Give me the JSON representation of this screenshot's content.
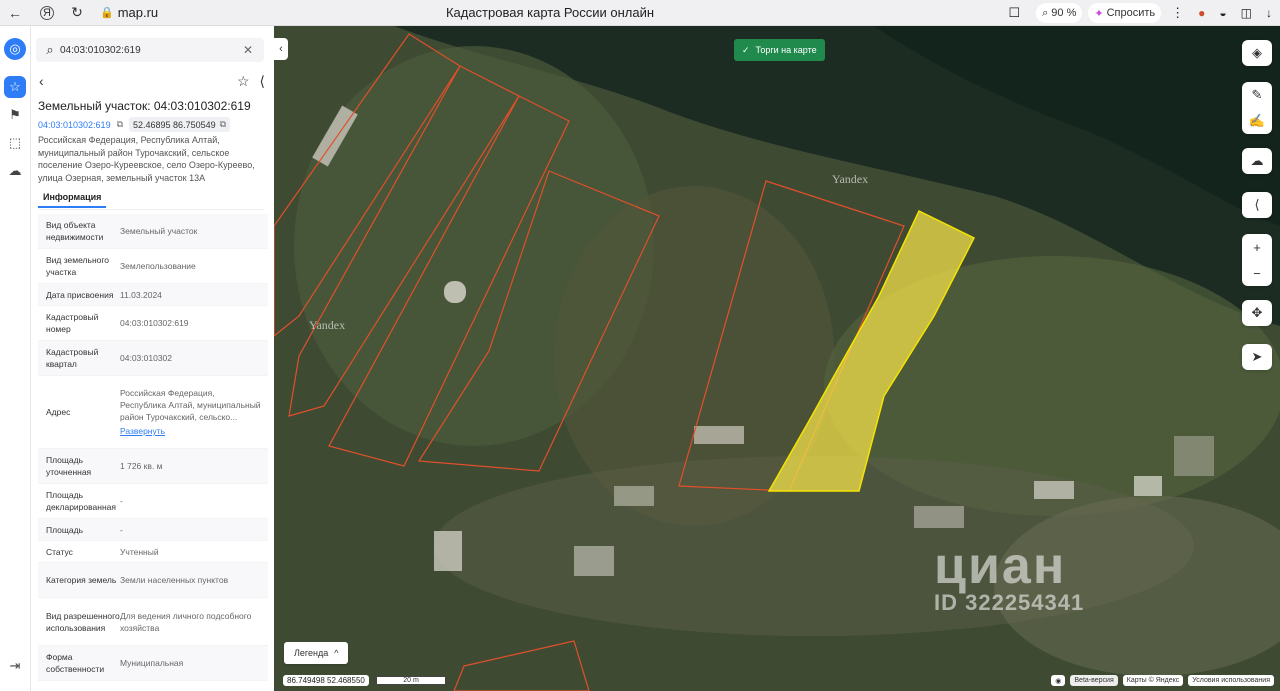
{
  "browser": {
    "url": "map.ru",
    "title": "Кадастровая карта России онлайн",
    "zoom": "90 %",
    "ask_label": "Спросить"
  },
  "search": {
    "value": "04:03:010302:619"
  },
  "object": {
    "title": "Земельный участок: 04:03:010302:619",
    "cadastral_link": "04:03:010302:619",
    "coordinates": "52.46895 86.750549",
    "address": "Российская Федерация, Республика Алтай, муниципальный район Турочакский, сельское поселение Озеро-Куреевское, село Озеро-Куреево, улица Озерная, земельный участок 13А"
  },
  "tabs": [
    {
      "label": "Информация"
    }
  ],
  "info_rows": [
    {
      "key": "Вид объекта недвижимости",
      "value": "Земельный участок"
    },
    {
      "key": "Вид земельного участка",
      "value": "Землепользование"
    },
    {
      "key": "Дата присвоения",
      "value": "11.03.2024"
    },
    {
      "key": "Кадастровый номер",
      "value": "04:03:010302:619"
    },
    {
      "key": "Кадастровый квартал",
      "value": "04:03:010302"
    },
    {
      "key": "Адрес",
      "value": "Российская Федерация, Республика Алтай, муниципальный район Турочакский, сельско...",
      "link": "Развернуть"
    },
    {
      "key": "Площадь уточненная",
      "value": "1 726 кв. м"
    },
    {
      "key": "Площадь декларированная",
      "value": "-"
    },
    {
      "key": "Площадь",
      "value": "-"
    },
    {
      "key": "Статус",
      "value": "Учтенный"
    },
    {
      "key": "Категория земель",
      "value": "Земли населенных пунктов"
    },
    {
      "key": "Вид разрешенного использования",
      "value": "Для ведения личного подсобного хозяйства"
    },
    {
      "key": "Форма собственности",
      "value": "Муниципальная"
    }
  ],
  "map": {
    "torgi_label": "Торги на карте",
    "legend_label": "Легенда",
    "cursor_coords": "86.749498  52.468550",
    "scale_label": "20 m",
    "yandex_label": "Yandex",
    "beta_label": "Beta-версия",
    "attribution": "Карты © Яндекс",
    "terms": "Условия использования",
    "watermark_brand": "циан",
    "watermark_id": "ID 322254341",
    "colors": {
      "parcel_outline": "#e0502a",
      "selected_fill": "#f2e04a",
      "selected_outline": "#f5e300",
      "accent": "#2e7cf6",
      "torgi": "#1f8a4c"
    }
  }
}
